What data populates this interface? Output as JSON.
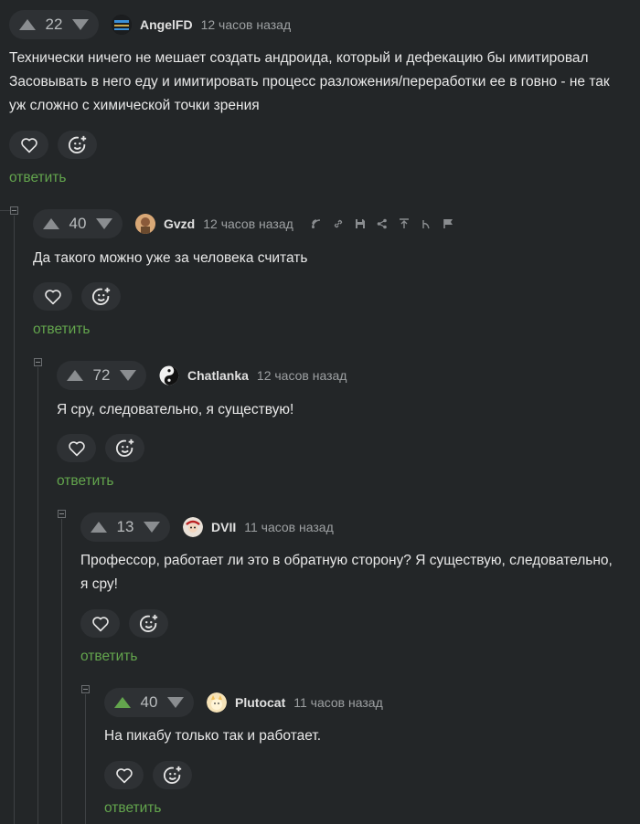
{
  "reply_label": "ответить",
  "colors": {
    "accent_green": "#63a54d",
    "background": "#232628",
    "button_bg": "#2e3134",
    "upvoted": "#63a54d"
  },
  "comments": [
    {
      "votes": "22",
      "username": "AngelFD",
      "time": "12 часов назад",
      "avatar_icon": "angelfd-avatar",
      "text": "Технически ничего не мешает создать андроида, который и дефекацию бы имитировал\nЗасовывать в него еду и имитировать процесс разложения/переработки ее в говно - не так уж сложно с химической точки зрения"
    },
    {
      "votes": "40",
      "username": "Gvzd",
      "time": "12 часов назад",
      "avatar_icon": "gvzd-avatar",
      "text": "Да такого можно уже за человека считать",
      "tools": [
        "branch-icon",
        "link-icon",
        "save-icon",
        "share-icon",
        "go-to-parent-icon",
        "user-icon",
        "report-flag-icon"
      ]
    },
    {
      "votes": "72",
      "username": "Chatlanka",
      "time": "12 часов назад",
      "avatar_icon": "yin-yang-avatar",
      "text": "Я сру, следовательно, я существую!"
    },
    {
      "votes": "13",
      "username": "DVII",
      "time": "11 часов назад",
      "avatar_icon": "dvii-avatar",
      "text": "Профессор, работает ли это в обратную сторону? Я существую, следовательно, я сру!"
    },
    {
      "votes": "40",
      "username": "Plutocat",
      "time": "11 часов назад",
      "avatar_icon": "plutocat-avatar",
      "upvoted": true,
      "text": "На пикабу только так и работает."
    }
  ]
}
